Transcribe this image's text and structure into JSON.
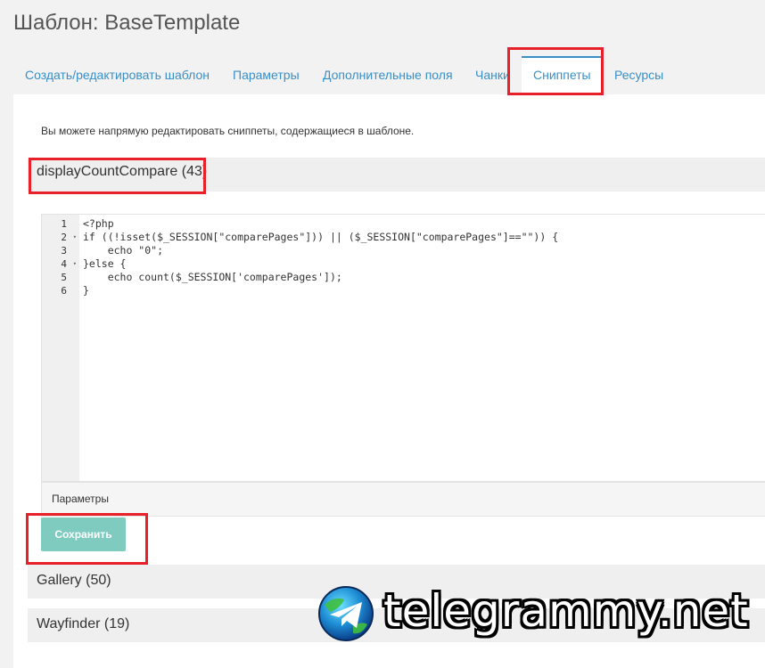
{
  "page": {
    "title": "Шаблон: BaseTemplate"
  },
  "tabs": [
    {
      "label": "Создать/редактировать шаблон",
      "active": false
    },
    {
      "label": "Параметры",
      "active": false
    },
    {
      "label": "Дополнительные поля",
      "active": false
    },
    {
      "label": "Чанки",
      "active": false
    },
    {
      "label": "Сниппеты",
      "active": true
    },
    {
      "label": "Ресурсы",
      "active": false
    }
  ],
  "panel": {
    "intro": "Вы можете напрямую редактировать сниппеты, содержащиеся в шаблоне."
  },
  "snippets": [
    {
      "title": "displayCountCompare (43)",
      "expanded": true
    },
    {
      "title": "Gallery (50)",
      "expanded": false
    },
    {
      "title": "Wayfinder (19)",
      "expanded": false
    }
  ],
  "editor": {
    "line_numbers": [
      "1",
      "2",
      "3",
      "4",
      "5",
      "6"
    ],
    "foldable_lines": [
      2,
      4
    ],
    "code_lines": [
      "<?php",
      "if ((!isset($_SESSION[\"comparePages\"])) || ($_SESSION[\"comparePages\"]==\"\")) {",
      "    echo \"0\";",
      "}else {",
      "    echo count($_SESSION['comparePages']);",
      "}"
    ]
  },
  "params_bar": {
    "label": "Параметры"
  },
  "actions": {
    "save_label": "Сохранить"
  },
  "watermark": {
    "text": "telegrammy.net",
    "icon": "telegram-globe-icon"
  },
  "colors": {
    "accent": "#3a8fc7",
    "save_button": "#7fcbc0",
    "highlight": "#e8202a"
  }
}
